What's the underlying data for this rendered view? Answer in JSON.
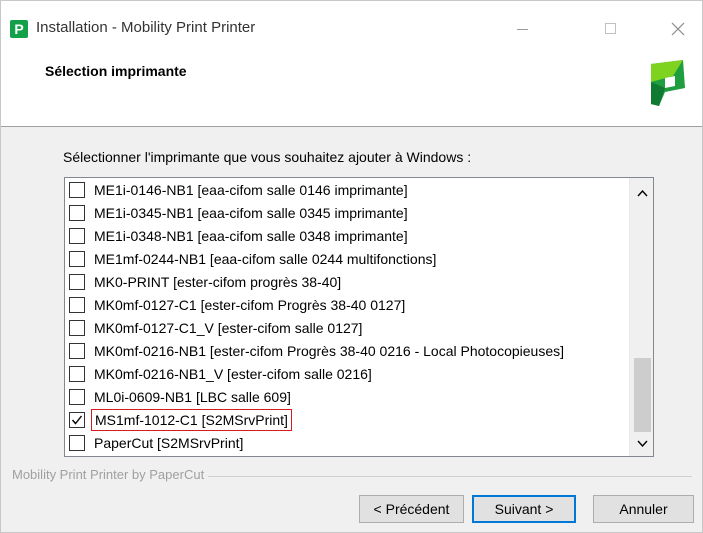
{
  "window": {
    "title": "Installation - Mobility Print Printer",
    "controls": {
      "minimize_icon": "minimize-icon",
      "maximize_icon": "maximize-icon",
      "close_icon": "close-icon"
    }
  },
  "header": {
    "title": "Sélection imprimante",
    "logo_icon": "papercut-logo-icon"
  },
  "instruction": "Sélectionner l'imprimante que vous souhaitez ajouter à Windows :",
  "printers": [
    {
      "label": "ME1i-0146-NB1 [eaa-cifom  salle 0146  imprimante]",
      "checked": false
    },
    {
      "label": "ME1i-0345-NB1 [eaa-cifom  salle 0345  imprimante]",
      "checked": false
    },
    {
      "label": "ME1i-0348-NB1 [eaa-cifom  salle 0348  imprimante]",
      "checked": false
    },
    {
      "label": "ME1mf-0244-NB1 [eaa-cifom  salle 0244  multifonctions]",
      "checked": false
    },
    {
      "label": "MK0-PRINT [ester-cifom  progrès 38-40]",
      "checked": false
    },
    {
      "label": "MK0mf-0127-C1 [ester-cifom  Progrès 38-40  0127]",
      "checked": false
    },
    {
      "label": "MK0mf-0127-C1_V [ester-cifom  salle 0127]",
      "checked": false
    },
    {
      "label": "MK0mf-0216-NB1 [ester-cifom  Progrès 38-40  0216 - Local Photocopieuses]",
      "checked": false
    },
    {
      "label": "MK0mf-0216-NB1_V [ester-cifom  salle 0216]",
      "checked": false
    },
    {
      "label": "ML0i-0609-NB1 [LBC  salle 609]",
      "checked": false
    },
    {
      "label": "MS1mf-1012-C1 [S2MSrvPrint]",
      "checked": true
    },
    {
      "label": "PaperCut [S2MSrvPrint]",
      "checked": false
    }
  ],
  "scroll": {
    "up_icon": "chevron-up-icon",
    "down_icon": "chevron-down-icon",
    "position": 0.8
  },
  "footer": {
    "brand": "Mobility Print Printer by PaperCut"
  },
  "buttons": {
    "previous": "< Précédent",
    "next": "Suivant >",
    "cancel": "Annuler"
  },
  "colors": {
    "accent": "#0078d7",
    "selection_highlight": "#d81b1b",
    "brand_green": "#12a04a"
  }
}
